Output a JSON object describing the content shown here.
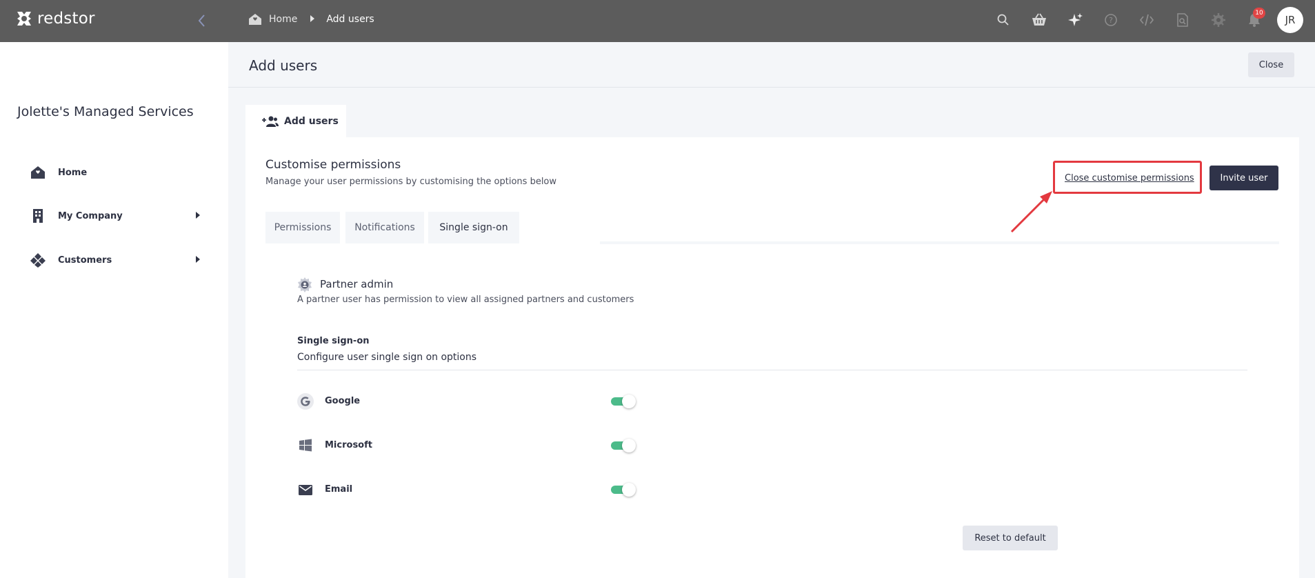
{
  "topbar": {
    "logo_text": "redstor",
    "breadcrumb": {
      "home": "Home",
      "current": "Add users"
    },
    "notification_count": "10",
    "avatar_initials": "JR",
    "icons": [
      "search-icon",
      "basket-icon",
      "sparkle-icon",
      "help-icon",
      "code-icon",
      "inspect-icon",
      "gear-icon",
      "bell-icon"
    ]
  },
  "sidebar": {
    "company": "Jolette's Managed Services",
    "items": [
      {
        "label": "Home",
        "icon": "home-icon"
      },
      {
        "label": "My Company",
        "icon": "building-icon"
      },
      {
        "label": "Customers",
        "icon": "customers-icon"
      }
    ]
  },
  "header": {
    "title": "Add users",
    "close_label": "Close"
  },
  "main_tab": {
    "label": "Add users"
  },
  "card": {
    "title": "Customise permissions",
    "subtitle": "Manage your user permissions by customising the options below",
    "close_customise_label": "Close customise permissions",
    "invite_label": "Invite user",
    "tabs": [
      {
        "label": "Permissions",
        "active": false
      },
      {
        "label": "Notifications",
        "active": false
      },
      {
        "label": "Single sign-on",
        "active": true
      }
    ],
    "role": {
      "title": "Partner admin",
      "description": "A partner user has permission to view all assigned partners and customers"
    },
    "sso": {
      "label": "Single sign-on",
      "description": "Configure user single sign on options",
      "options": [
        {
          "label": "Google",
          "enabled": true,
          "icon": "google-icon"
        },
        {
          "label": "Microsoft",
          "enabled": true,
          "icon": "windows-icon"
        },
        {
          "label": "Email",
          "enabled": true,
          "icon": "email-icon"
        }
      ]
    },
    "reset_label": "Reset to default"
  },
  "colors": {
    "topbar": "#5c5c5c",
    "primary_button": "#2f3349",
    "toggle_on": "#4cbb8a",
    "highlight": "#e3393f",
    "badge": "#e04545"
  }
}
